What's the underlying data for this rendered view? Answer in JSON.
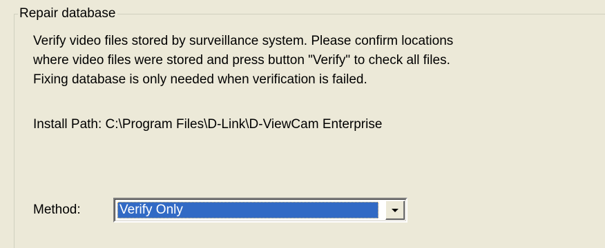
{
  "group": {
    "title": "Repair database"
  },
  "description": {
    "lines": [
      "Verify video files stored by surveillance system. Please confirm locations",
      "where video files were stored and press button \"Verify\" to check all files.",
      "Fixing database is only needed when verification is failed."
    ]
  },
  "install_path": {
    "text": "Install Path: C:\\Program Files\\D-Link\\D-ViewCam Enterprise"
  },
  "method": {
    "label": "Method:",
    "selected": "Verify Only",
    "dropdown_icon": "chevron-down-icon"
  },
  "colors": {
    "background": "#ece9d8",
    "selection": "#316ac5",
    "groupbox_border": "#d0d0bf"
  }
}
